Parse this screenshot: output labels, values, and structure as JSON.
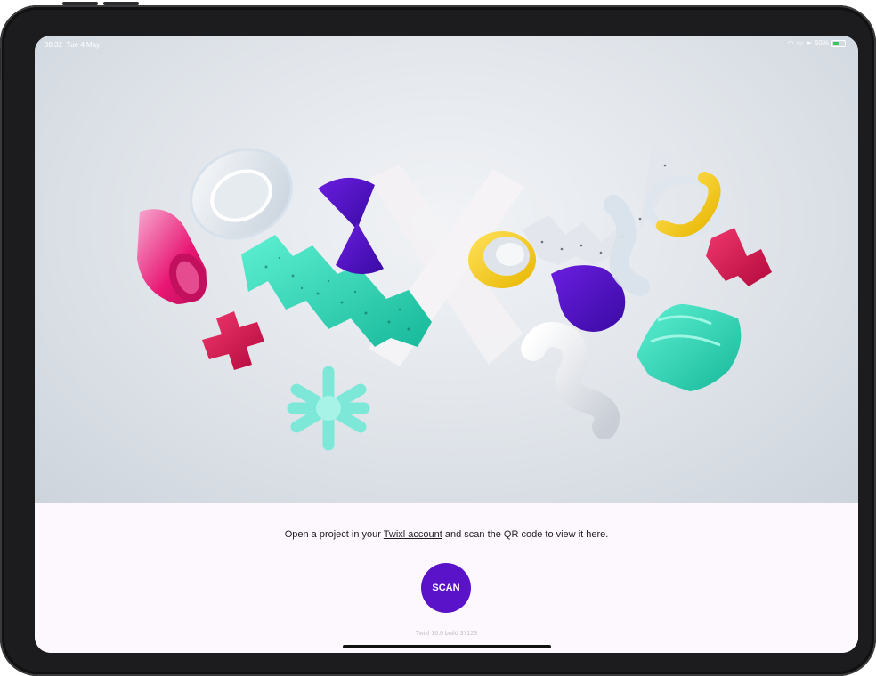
{
  "status_bar": {
    "time": "08:32",
    "date": "Tue 4 May",
    "battery": "50%",
    "battery_level": 0.5,
    "icons": [
      "wifi-icon",
      "screen-mirroring-icon",
      "location-icon",
      "battery-charging-icon"
    ]
  },
  "hero": {
    "logo_icon": "twixl-x-logo-icon",
    "illustration": "3d-shapes-illustration"
  },
  "main": {
    "message_prefix": "Open a project in your ",
    "message_link": "Twixl account",
    "message_suffix": " and scan the QR code to view it here.",
    "scan_label": "SCAN",
    "version": "Twixl 16.0 build 37123"
  },
  "colors": {
    "accent": "#5b13c9",
    "background": "#fdf8fd",
    "hero_bg": "#e3e7ec"
  }
}
